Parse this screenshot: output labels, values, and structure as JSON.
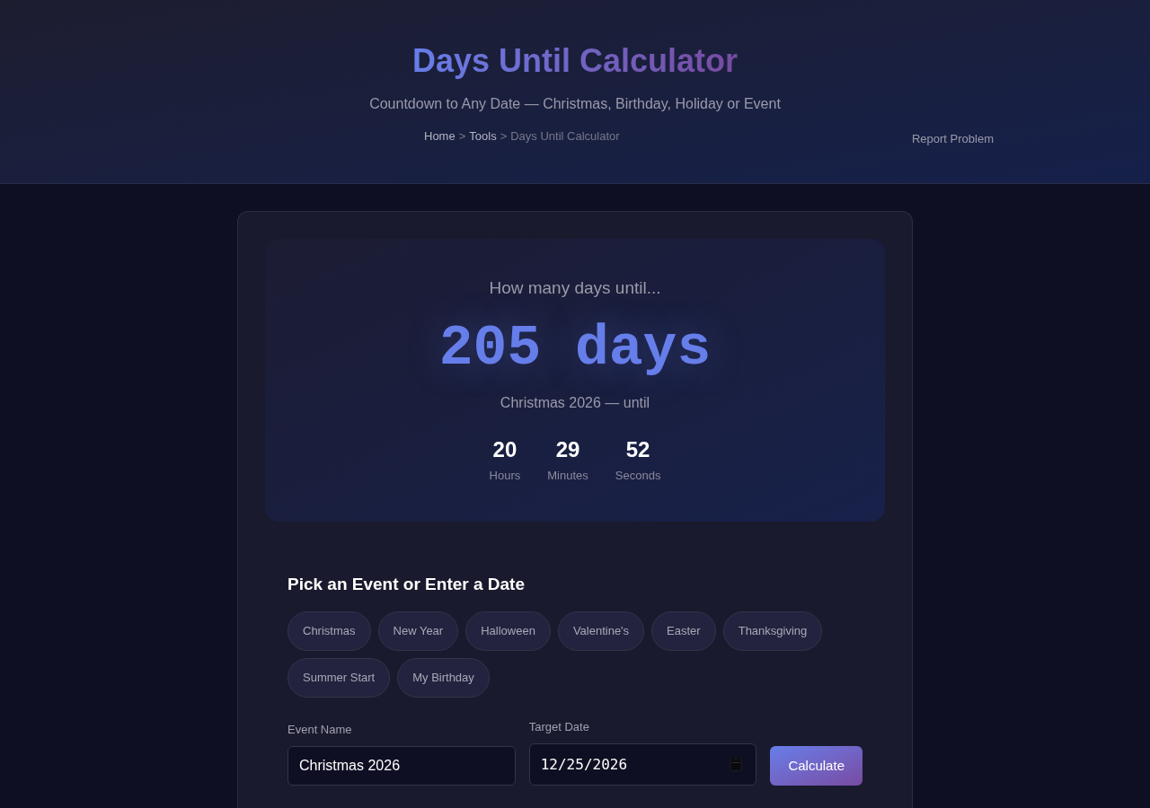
{
  "header": {
    "title": "Days Until Calculator",
    "subtitle": "Countdown to Any Date — Christmas, Birthday, Holiday or Event",
    "breadcrumb": [
      {
        "kind": "link",
        "text": "Home"
      },
      {
        "kind": "separator",
        "text": ">"
      },
      {
        "kind": "link",
        "text": "Tools"
      },
      {
        "kind": "separator",
        "text": ">"
      },
      {
        "kind": "current",
        "text": "Days Until Calculator"
      }
    ],
    "report_link": "Report Problem"
  },
  "result": {
    "prompt": "How many days until...",
    "days": "205 days",
    "caption": "Christmas 2026 — until",
    "units": [
      {
        "value": "20",
        "label": "Hours"
      },
      {
        "value": "29",
        "label": "Minutes"
      },
      {
        "value": "52",
        "label": "Seconds"
      }
    ]
  },
  "form": {
    "heading": "Pick an Event or Enter a Date",
    "presets": [
      {
        "label": "Christmas",
        "selected": false
      },
      {
        "label": "New Year",
        "selected": false
      },
      {
        "label": "Halloween",
        "selected": false
      },
      {
        "label": "Valentine's",
        "selected": false
      },
      {
        "label": "Easter",
        "selected": false
      },
      {
        "label": "Thanksgiving",
        "selected": false
      },
      {
        "label": "Summer Start",
        "selected": false
      },
      {
        "label": "My Birthday",
        "selected": false
      }
    ],
    "event_name": {
      "label": "Event Name",
      "value": "Christmas 2026"
    },
    "target_date": {
      "label": "Target Date",
      "value": "12/25/2026"
    },
    "submit": "Calculate"
  }
}
